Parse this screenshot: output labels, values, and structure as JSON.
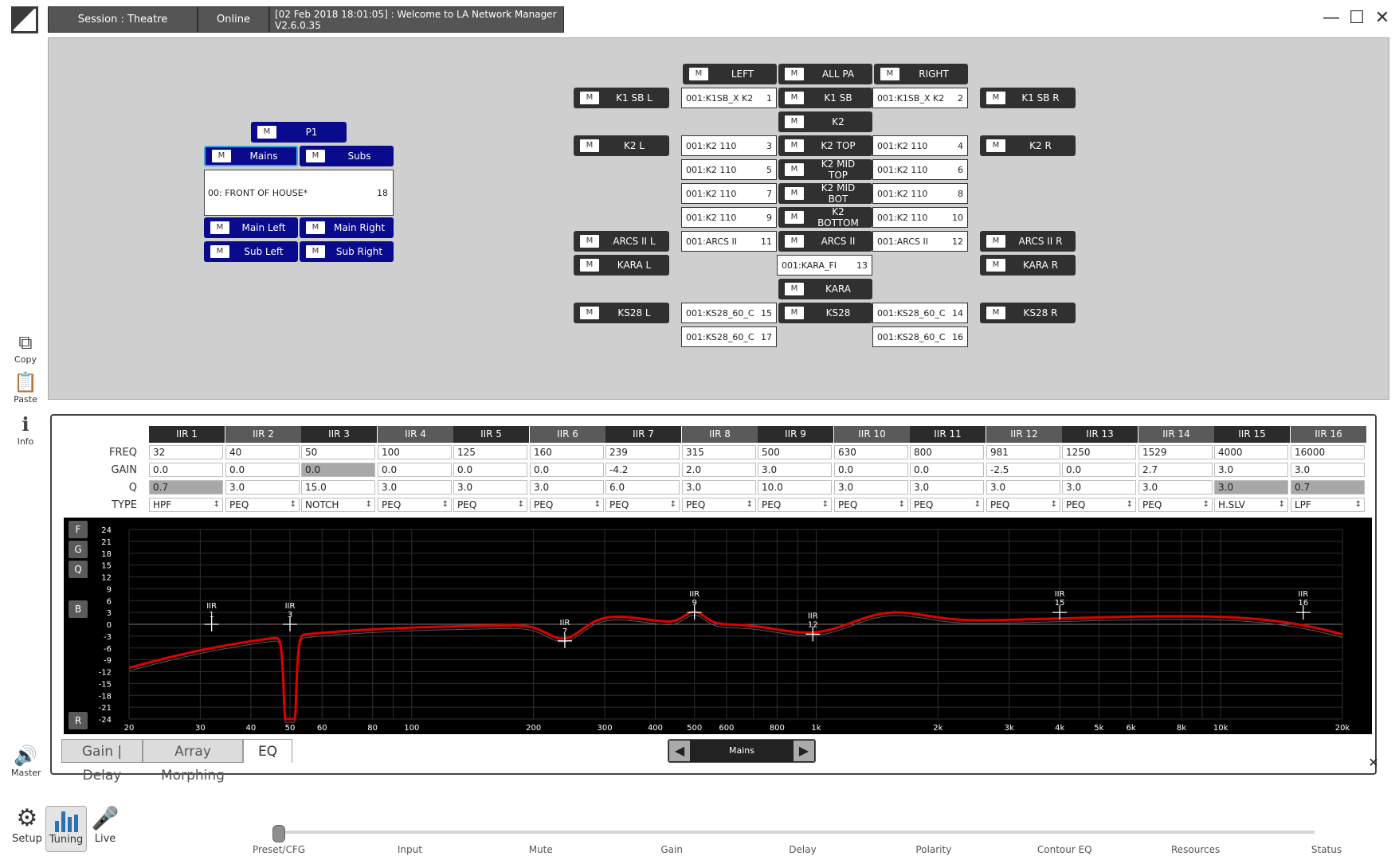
{
  "header": {
    "session": "Session : Theatre",
    "status": "Online",
    "message": "[02 Feb 2018 18:01:05] : Welcome to LA Network Manager V2.6.0.35",
    "minimize": "—",
    "maximize": "☐",
    "close": "✕"
  },
  "side_tools": [
    {
      "label": "Copy",
      "icon": "copy-icon"
    },
    {
      "label": "Paste",
      "icon": "paste-icon"
    },
    {
      "label": "Info",
      "icon": "info-icon"
    },
    {
      "label": "Master",
      "icon": "speaker-icon"
    }
  ],
  "mute_label": "M",
  "groups_p1": {
    "p1": "P1",
    "mains": "Mains",
    "subs": "Subs",
    "foh_name": "00: FRONT OF HOUSE*",
    "foh_num": "18",
    "main_left": "Main Left",
    "main_right": "Main Right",
    "sub_left": "Sub Left",
    "sub_right": "Sub Right"
  },
  "groups_center": [
    "LEFT",
    "ALL PA",
    "RIGHT",
    "K1 SB",
    "K2",
    "K2 TOP",
    "K2 MID TOP",
    "K2 MID BOT",
    "K2 BOTTOM",
    "ARCS II",
    "KARA",
    "KS28"
  ],
  "groups_side": [
    "K1 SB L",
    "K1 SB R",
    "K2 L",
    "K2 R",
    "ARCS II L",
    "ARCS II R",
    "KARA L",
    "KARA R",
    "KS28 L",
    "KS28 R"
  ],
  "amps": [
    {
      "name": "001:K1SB_X K2",
      "num": "1"
    },
    {
      "name": "001:K1SB_X K2",
      "num": "2"
    },
    {
      "name": "001:K2 110",
      "num": "3"
    },
    {
      "name": "001:K2 110",
      "num": "4"
    },
    {
      "name": "001:K2 110",
      "num": "5"
    },
    {
      "name": "001:K2 110",
      "num": "6"
    },
    {
      "name": "001:K2 110",
      "num": "7"
    },
    {
      "name": "001:K2 110",
      "num": "8"
    },
    {
      "name": "001:K2 110",
      "num": "9"
    },
    {
      "name": "001:K2 110",
      "num": "10"
    },
    {
      "name": "001:ARCS II",
      "num": "11"
    },
    {
      "name": "001:ARCS II",
      "num": "12"
    },
    {
      "name": "001:KARA_FI",
      "num": "13"
    },
    {
      "name": "001:KS28_60_C",
      "num": "15"
    },
    {
      "name": "001:KS28_60_C",
      "num": "14"
    },
    {
      "name": "001:KS28_60_C",
      "num": "17"
    },
    {
      "name": "001:KS28_60_C",
      "num": "16"
    }
  ],
  "eq": {
    "row_labels": [
      "FREQ",
      "GAIN",
      "Q",
      "TYPE"
    ],
    "filters": [
      {
        "name": "IIR 1",
        "freq": "32",
        "gain": "0.0",
        "q": "0.7",
        "type": "HPF"
      },
      {
        "name": "IIR 2",
        "freq": "40",
        "gain": "0.0",
        "q": "3.0",
        "type": "PEQ"
      },
      {
        "name": "IIR 3",
        "freq": "50",
        "gain": "0.0",
        "q": "15.0",
        "type": "NOTCH"
      },
      {
        "name": "IIR 4",
        "freq": "100",
        "gain": "0.0",
        "q": "3.0",
        "type": "PEQ"
      },
      {
        "name": "IIR 5",
        "freq": "125",
        "gain": "0.0",
        "q": "3.0",
        "type": "PEQ"
      },
      {
        "name": "IIR 6",
        "freq": "160",
        "gain": "0.0",
        "q": "3.0",
        "type": "PEQ"
      },
      {
        "name": "IIR 7",
        "freq": "239",
        "gain": "-4.2",
        "q": "6.0",
        "type": "PEQ"
      },
      {
        "name": "IIR 8",
        "freq": "315",
        "gain": "2.0",
        "q": "3.0",
        "type": "PEQ"
      },
      {
        "name": "IIR 9",
        "freq": "500",
        "gain": "3.0",
        "q": "10.0",
        "type": "PEQ"
      },
      {
        "name": "IIR 10",
        "freq": "630",
        "gain": "0.0",
        "q": "3.0",
        "type": "PEQ"
      },
      {
        "name": "IIR 11",
        "freq": "800",
        "gain": "0.0",
        "q": "3.0",
        "type": "PEQ"
      },
      {
        "name": "IIR 12",
        "freq": "981",
        "gain": "-2.5",
        "q": "3.0",
        "type": "PEQ"
      },
      {
        "name": "IIR 13",
        "freq": "1250",
        "gain": "0.0",
        "q": "3.0",
        "type": "PEQ"
      },
      {
        "name": "IIR 14",
        "freq": "1529",
        "gain": "2.7",
        "q": "3.0",
        "type": "PEQ"
      },
      {
        "name": "IIR 15",
        "freq": "4000",
        "gain": "3.0",
        "q": "3.0",
        "type": "H.SLV"
      },
      {
        "name": "IIR 16",
        "freq": "16000",
        "gain": "3.0",
        "q": "0.7",
        "type": "LPF"
      }
    ],
    "graph_buttons": [
      "F",
      "G",
      "Q",
      "B",
      "R"
    ],
    "y_ticks": [
      "24",
      "21",
      "18",
      "15",
      "12",
      "9",
      "6",
      "3",
      "0",
      "-3",
      "-6",
      "-9",
      "-12",
      "-15",
      "-18",
      "-21",
      "-24"
    ],
    "x_ticks": [
      "20",
      "30",
      "40",
      "50",
      "60",
      "80",
      "100",
      "200",
      "300",
      "400",
      "500",
      "600",
      "800",
      "1k",
      "2k",
      "3k",
      "4k",
      "5k",
      "6k",
      "8k",
      "10k",
      "20k"
    ],
    "markers": [
      {
        "label": "IIR 1",
        "freq": 32,
        "gain": 0
      },
      {
        "label": "IIR 3",
        "freq": 50,
        "gain": 0
      },
      {
        "label": "IIR 7",
        "freq": 239,
        "gain": -4.2
      },
      {
        "label": "IIR 9",
        "freq": 500,
        "gain": 3
      },
      {
        "label": "IIR 12",
        "freq": 981,
        "gain": -2.5
      },
      {
        "label": "IIR 15",
        "freq": 4000,
        "gain": 3
      },
      {
        "label": "IIR 16",
        "freq": 16000,
        "gain": 3
      }
    ],
    "curve_color": "#e00000"
  },
  "tabs": [
    "Gain | Delay",
    "Array Morphing",
    "EQ"
  ],
  "nav": {
    "current": "Mains",
    "prev": "◀",
    "next": "▶",
    "close": "✕"
  },
  "bottom_tools": [
    "Setup",
    "Tuning",
    "Live"
  ],
  "timeline": {
    "stages": [
      "Preset/CFG",
      "Input",
      "Mute",
      "Gain",
      "Delay",
      "Polarity",
      "Contour EQ",
      "Resources",
      "Status"
    ],
    "position": 0
  }
}
